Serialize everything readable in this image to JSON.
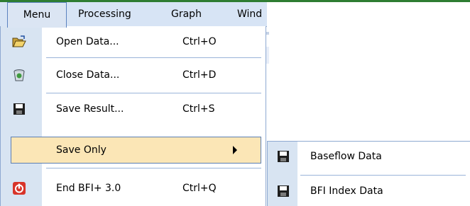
{
  "menubar": {
    "items": [
      {
        "label": "Menu",
        "active": true
      },
      {
        "label": "Processing"
      },
      {
        "label": "Graph"
      },
      {
        "label": "Wind"
      }
    ]
  },
  "menu": {
    "items": [
      {
        "label": "Open Data...",
        "shortcut": "Ctrl+O",
        "icon": "folder-open-icon"
      },
      {
        "label": "Close Data...",
        "shortcut": "Ctrl+D",
        "icon": "recycle-bin-icon"
      },
      {
        "label": "Save Result...",
        "shortcut": "Ctrl+S",
        "icon": "floppy-disk-icon"
      },
      {
        "label": "Save Only",
        "shortcut": "",
        "icon": "",
        "has_submenu": true,
        "highlighted": true
      },
      {
        "label": "End BFI+ 3.0",
        "shortcut": "Ctrl+Q",
        "icon": "power-icon"
      }
    ]
  },
  "submenu": {
    "items": [
      {
        "label": "Baseflow Data",
        "icon": "floppy-disk-icon"
      },
      {
        "label": "BFI Index Data",
        "icon": "floppy-disk-icon"
      }
    ]
  },
  "colors": {
    "menubar_bg": "#d7e4f5",
    "gutter": "#d8e4f2",
    "highlight_bg": "#fbe6b6",
    "highlight_border": "#5d7fb2",
    "accent_line": "#2e7d32"
  }
}
